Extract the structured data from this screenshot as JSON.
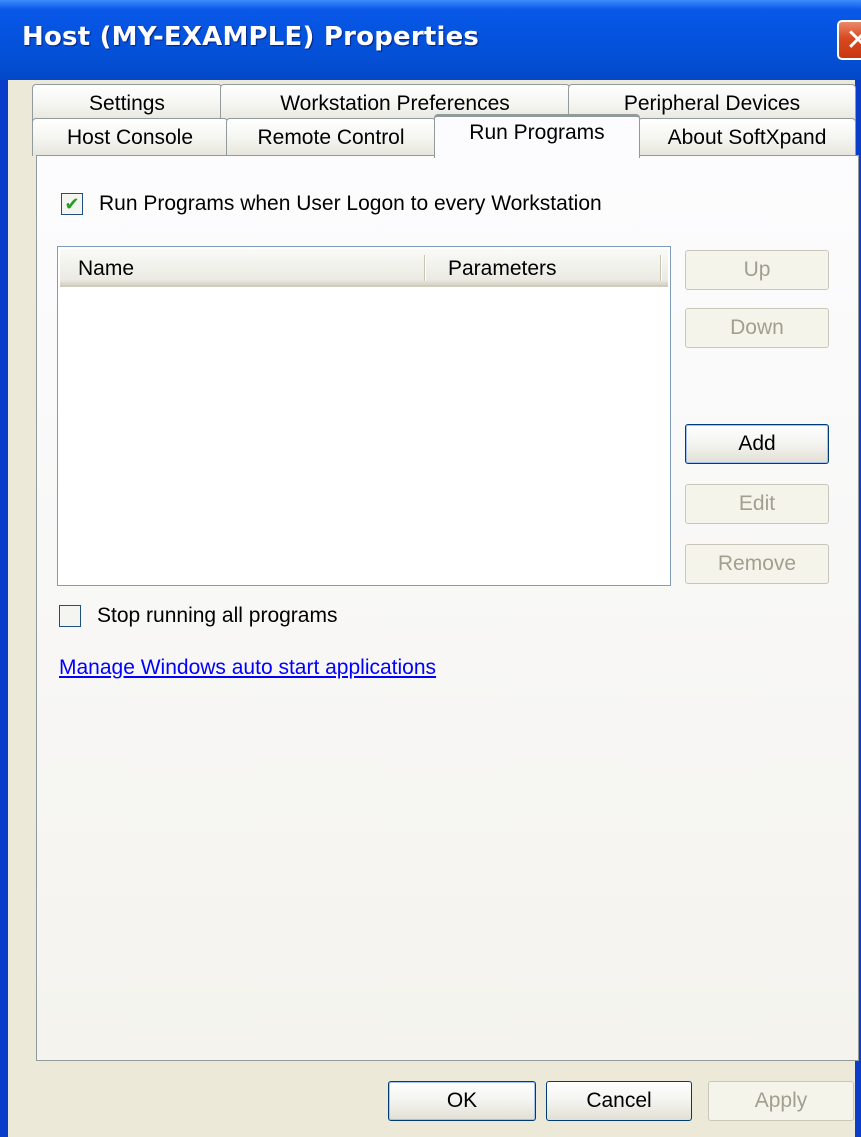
{
  "window": {
    "title": "Host (MY-EXAMPLE) Properties",
    "close_glyph": "✕"
  },
  "tabs_row1": [
    "Settings",
    "Workstation Preferences",
    "Peripheral Devices"
  ],
  "tabs_row2": [
    "Host Console",
    "Remote Control",
    "Run Programs",
    "About SoftXpand"
  ],
  "active_tab": "Run Programs",
  "run_programs": {
    "run_on_logon_label": "Run Programs when User Logon to every Workstation",
    "run_on_logon_checked": true,
    "list_columns": [
      "Name",
      "Parameters"
    ],
    "list_rows": [],
    "buttons": {
      "up": "Up",
      "down": "Down",
      "add": "Add",
      "edit": "Edit",
      "remove": "Remove"
    },
    "stop_all_label": "Stop running all programs",
    "stop_all_checked": false,
    "manage_link": "Manage Windows auto start applications"
  },
  "footer": {
    "ok": "OK",
    "cancel": "Cancel",
    "apply": "Apply"
  }
}
